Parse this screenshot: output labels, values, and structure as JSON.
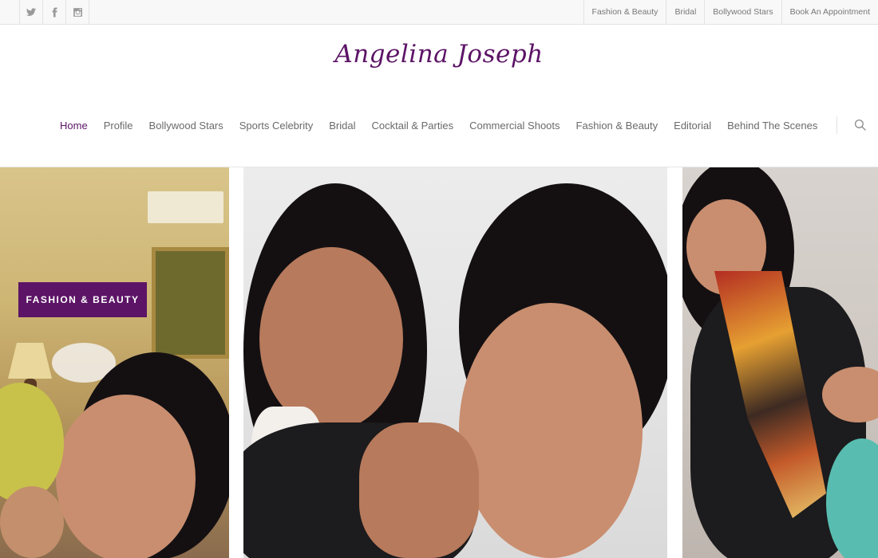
{
  "topbar": {
    "social": [
      {
        "name": "twitter-icon"
      },
      {
        "name": "facebook-icon"
      },
      {
        "name": "instagram-icon"
      }
    ],
    "links": [
      "Fashion & Beauty",
      "Bridal",
      "Bollywood Stars",
      "Book An Appointment"
    ]
  },
  "header": {
    "logo": "Angelina Joseph"
  },
  "nav": {
    "items": [
      "Home",
      "Profile",
      "Bollywood Stars",
      "Sports Celebrity",
      "Bridal",
      "Cocktail & Parties",
      "Commercial Shoots",
      "Fashion & Beauty",
      "Editorial",
      "Behind The Scenes"
    ],
    "active": "Home",
    "search_icon": "search-icon"
  },
  "gallery": {
    "badge": "Fashion & Beauty"
  },
  "colors": {
    "brand": "#5c1466",
    "topbar_bg": "#f8f8f8",
    "text": "#676767"
  }
}
